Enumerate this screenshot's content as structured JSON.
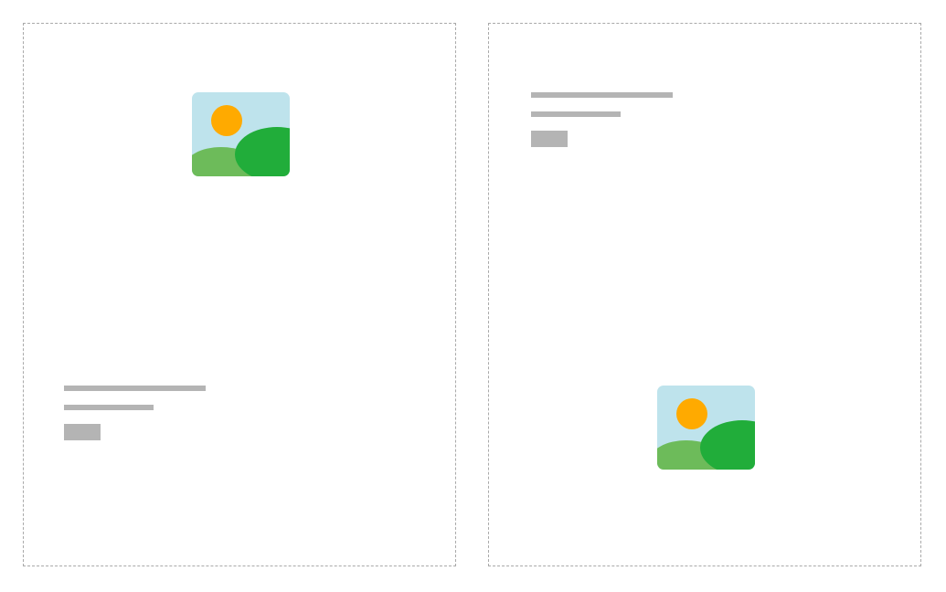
{
  "colors": {
    "border": "#a9a9a9",
    "placeholder": "#b4b4b4",
    "sky": "#bee3ec",
    "sun": "#ffaa00",
    "hill_back": "#6dbb5a",
    "hill_front": "#21ad3a"
  },
  "panels": [
    {
      "name": "left",
      "order": [
        "image-icon",
        "text-block"
      ],
      "icon": "image-placeholder-icon"
    },
    {
      "name": "right",
      "order": [
        "text-block",
        "image-icon"
      ],
      "icon": "image-placeholder-icon"
    }
  ]
}
